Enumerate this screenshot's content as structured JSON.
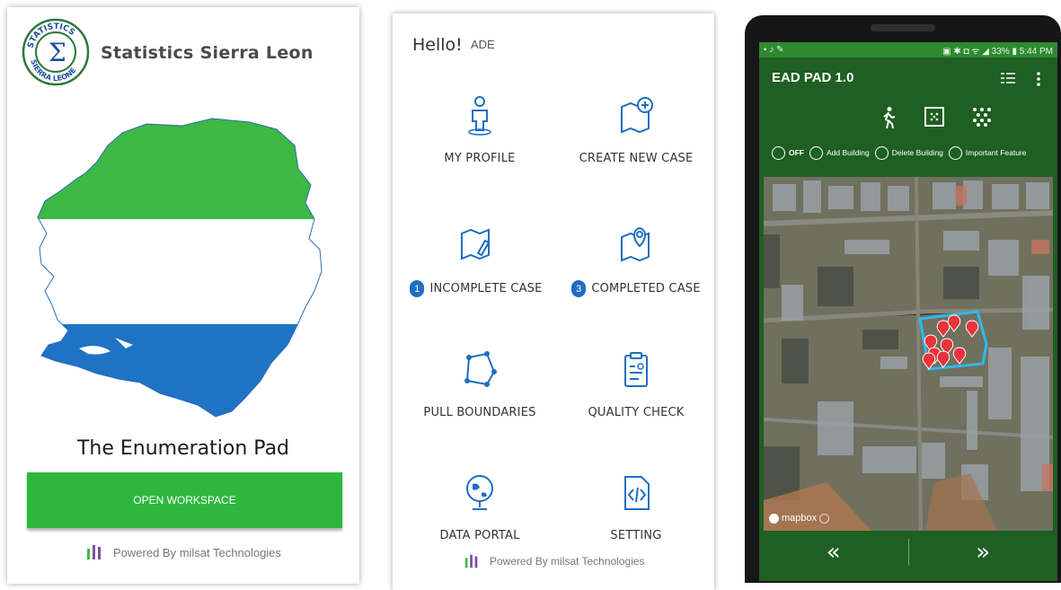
{
  "splash": {
    "org_name": "Statistics Sierra Leon",
    "logo_text_top": "STATISTICS",
    "logo_text_bottom": "SIERRA LEONE",
    "app_title": "The Enumeration Pad",
    "open_button": "OPEN WORKSPACE",
    "powered_by": "Powered By milsat Technologies",
    "flag_colors": [
      "#3db842",
      "#ffffff",
      "#1e73c4"
    ]
  },
  "dashboard": {
    "greeting": "Hello!",
    "username": "ADE",
    "tiles": [
      {
        "label": "MY PROFILE",
        "icon": "profile-icon"
      },
      {
        "label": "CREATE NEW CASE",
        "icon": "map-add-icon"
      },
      {
        "label": "INCOMPLETE CASE",
        "icon": "map-edit-icon",
        "badge": "1"
      },
      {
        "label": "COMPLETED CASE",
        "icon": "map-pin-icon",
        "badge": "3"
      },
      {
        "label": "PULL BOUNDARIES",
        "icon": "polygon-icon"
      },
      {
        "label": "QUALITY CHECK",
        "icon": "clipboard-icon"
      },
      {
        "label": "DATA PORTAL",
        "icon": "globe-icon"
      },
      {
        "label": "SETTING",
        "icon": "code-file-icon"
      }
    ],
    "powered_by": "Powered By milsat Technologies",
    "accent": "#1e6fc2"
  },
  "mapscreen": {
    "status_left": "▪ ♪ ✎",
    "status_right": "▣ ✱ ◘ ᯤ ◢ 33% ▮ 5:44 PM",
    "title": "EAD PAD 1.0",
    "tools": [
      "walk-icon",
      "grid-box-icon",
      "dots-pattern-icon"
    ],
    "modes": [
      {
        "label": "OFF",
        "bold": true
      },
      {
        "label": "Add Building"
      },
      {
        "label": "Delete Building"
      },
      {
        "label": "Important Feature"
      }
    ],
    "map_attribution": "mapbox",
    "nav_prev": "«",
    "nav_next": "»",
    "theme_color": "#1f5f22"
  }
}
